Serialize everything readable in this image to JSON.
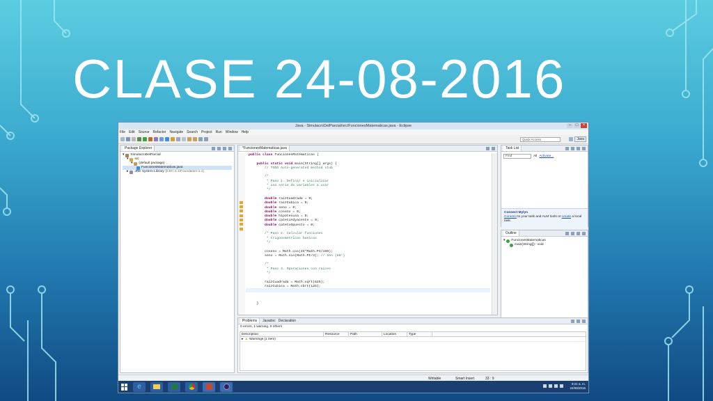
{
  "slide": {
    "title": "CLASE 24-08-2016"
  },
  "window": {
    "title": "Java - SimulacroDelParcial/src/FuncionesMatematicas.java - Eclipse",
    "menu": [
      "File",
      "Edit",
      "Source",
      "Refactor",
      "Navigate",
      "Search",
      "Project",
      "Run",
      "Window",
      "Help"
    ],
    "quick_access": "Quick Access",
    "perspective": "Java"
  },
  "package_explorer": {
    "tab": "Package Explorer",
    "items": [
      "SimulacroDelParcial",
      "src",
      "(default package)",
      "FuncionesMatematicas.java",
      "JRE System Library",
      "[CDC-1.1/Foundation-1.1]"
    ]
  },
  "editor": {
    "tab": "*FuncionesMatematicas.java",
    "lines": [
      "public class FuncionesMatematicas {",
      "",
      "    public static void main(String[] args) {",
      "        // TODO Auto-generated method stub",
      "",
      "        /*",
      "         * Paso 1. Definir e inicializar",
      "         * una serie de variables a usar",
      "         */",
      "",
      "        double raizCuadrada = 0;",
      "        double raizCubica = 0;",
      "        double seno = 0;",
      "        double coseno = 0;",
      "        double hipotenusa = 0;",
      "        double catetoAdyacente = 0;",
      "        double catetoOpuesto = 0;",
      "",
      "        /* Paso 2. Calcular funciones",
      "         * trigonometricas basicas",
      "         */",
      "",
      "        coseno = Math.cos(45*Math.PI/180);",
      "        seno = Math.sin(Math.PI/3); // Sen (60°)",
      "",
      "        /*",
      "         * Paso 3. Operaciones con raices",
      "         */",
      "",
      "        raizCuadrada = Math.sqrt(625);",
      "        raizCubica = Math.cbrt(125);",
      "",
      "",
      "",
      "    }"
    ]
  },
  "task_list": {
    "tab": "Task List",
    "find_placeholder": "Find",
    "all_label": "All",
    "activate_label": "Activate...",
    "mylyn_title": "Connect Mylyn",
    "mylyn_connect": "Connect",
    "mylyn_text_mid": " to your task and ALM tools or ",
    "mylyn_create": "create",
    "mylyn_text_end": " a local task."
  },
  "outline": {
    "tab": "Outline",
    "items": [
      "FuncionesMatematicas",
      "main(String[]) : void"
    ]
  },
  "bottom_panel": {
    "tabs": [
      "Problems",
      "Javadoc",
      "Declaration"
    ],
    "summary": "0 errors, 1 warning, 0 others",
    "columns": [
      "Description",
      "Resource",
      "Path",
      "Location",
      "Type"
    ],
    "rows": [
      {
        "description": "Warnings (1 item)"
      }
    ]
  },
  "status": {
    "mode": "Writable",
    "insert": "Smart Insert",
    "position": "33 : 9"
  },
  "taskbar": {
    "time": "9:21 a. m.",
    "date": "24/08/2016"
  },
  "colors": {
    "keyword": "#7f0055",
    "comment": "#3f7f5f",
    "taskbar": "#1a3f73"
  }
}
